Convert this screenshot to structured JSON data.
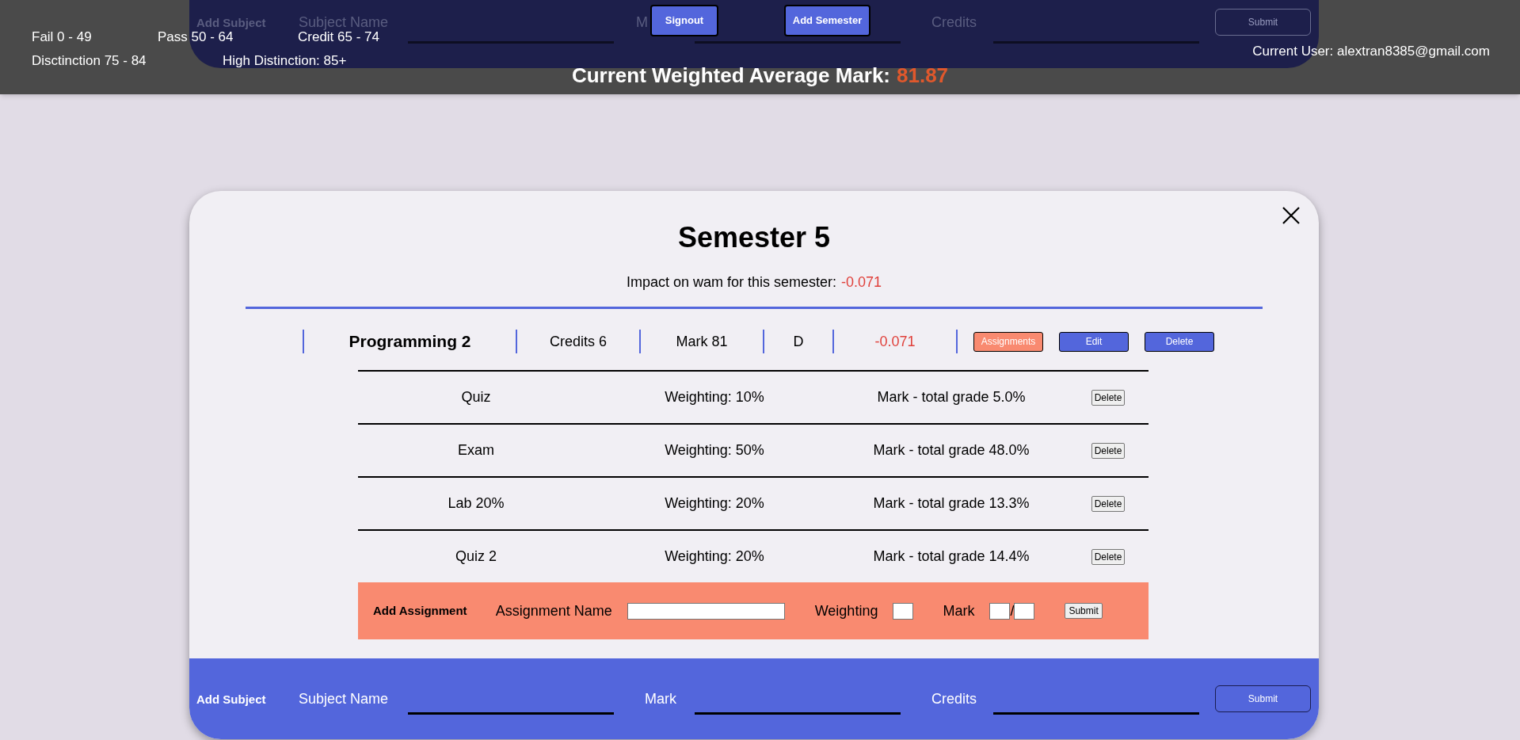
{
  "background_form": {
    "title": "Add Subject",
    "fields": [
      "Subject Name",
      "M",
      "Credits"
    ],
    "submit": "Submit"
  },
  "header": {
    "grade_bands": [
      [
        "Fail 0 - 49",
        "Pass 50 - 64",
        "Credit 65 - 74"
      ],
      [
        "Disctinction 75 - 84",
        "High Distinction: 85+"
      ]
    ],
    "buttons": [
      "Signout",
      "Add Semester"
    ],
    "current_user": "Current User: alextran8385@gmail.com",
    "wam_label": "Current Weighted Average Mark:",
    "wam_value": "81.87"
  },
  "semester": {
    "title": "Semester 5",
    "impact_label": "Impact on wam for this semester:",
    "impact_value": "-0.071",
    "subjects": [
      {
        "name": "Programming 2",
        "credits": "Credits 6",
        "mark": "Mark 81",
        "grade": "D",
        "impact": "-0.071",
        "expanded": true,
        "buttons": [
          "Assignments",
          "Edit",
          "Delete"
        ],
        "assignments": [
          {
            "name": "Quiz",
            "weighting": "Weighting: 10%",
            "total": "Mark - total grade 5.0%",
            "delete": "Delete"
          },
          {
            "name": "Exam",
            "weighting": "Weighting: 50%",
            "total": "Mark - total grade 48.0%",
            "delete": "Delete"
          },
          {
            "name": "Lab 20%",
            "weighting": "Weighting: 20%",
            "total": "Mark - total grade 13.3%",
            "delete": "Delete"
          },
          {
            "name": "Quiz 2",
            "weighting": "Weighting: 20%",
            "total": "Mark - total grade 14.4%",
            "delete": "Delete"
          }
        ],
        "add_assignment": {
          "title": "Add Assignment",
          "name_label": "Assignment Name",
          "weighting_label": "Weighting",
          "mark_label": "Mark",
          "separator": "/",
          "submit": "Submit"
        }
      }
    ]
  },
  "add_subject": {
    "title": "Add Subject",
    "fields": [
      "Subject Name",
      "Mark",
      "Credits"
    ],
    "submit": "Submit"
  }
}
